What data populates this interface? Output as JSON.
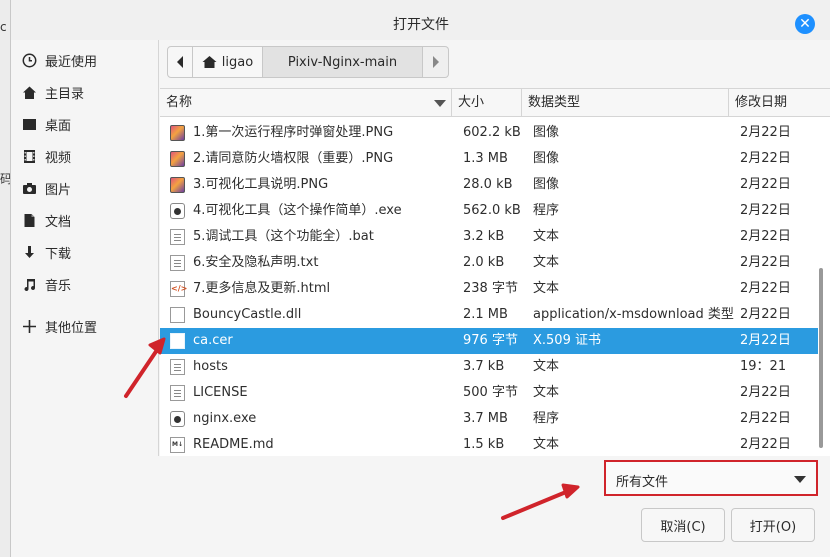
{
  "window": {
    "title": "打开文件"
  },
  "background": {
    "glyph_top": "c",
    "glyph_mid": "码"
  },
  "sidebar": {
    "items": [
      {
        "label": "最近使用",
        "icon": "clock-icon"
      },
      {
        "label": "主目录",
        "icon": "home-icon"
      },
      {
        "label": "桌面",
        "icon": "desktop-icon"
      },
      {
        "label": "视频",
        "icon": "video-icon"
      },
      {
        "label": "图片",
        "icon": "camera-icon"
      },
      {
        "label": "文档",
        "icon": "document-icon"
      },
      {
        "label": "下载",
        "icon": "download-icon"
      },
      {
        "label": "音乐",
        "icon": "music-icon"
      },
      {
        "label": "其他位置",
        "icon": "plus-icon"
      }
    ]
  },
  "pathbar": {
    "home": "ligao",
    "current": "Pixiv-Nginx-main"
  },
  "columns": {
    "name": "名称",
    "size": "大小",
    "type": "数据类型",
    "date": "修改日期"
  },
  "files": [
    {
      "name": "1.第一次运行程序时弹窗处理.PNG",
      "size": "602.2 kB",
      "type": "图像",
      "date": "2月22日",
      "icon": "image-icon"
    },
    {
      "name": "2.请同意防火墙权限（重要）.PNG",
      "size": "1.3 MB",
      "type": "图像",
      "date": "2月22日",
      "icon": "image-icon"
    },
    {
      "name": "3.可视化工具说明.PNG",
      "size": "28.0 kB",
      "type": "图像",
      "date": "2月22日",
      "icon": "image-icon"
    },
    {
      "name": "4.可视化工具（这个操作简单）.exe",
      "size": "562.0 kB",
      "type": "程序",
      "date": "2月22日",
      "icon": "executable-icon"
    },
    {
      "name": "5.调试工具（这个功能全）.bat",
      "size": "3.2 kB",
      "type": "文本",
      "date": "2月22日",
      "icon": "text-file-icon"
    },
    {
      "name": "6.安全及隐私声明.txt",
      "size": "2.0 kB",
      "type": "文本",
      "date": "2月22日",
      "icon": "text-file-icon"
    },
    {
      "name": "7.更多信息及更新.html",
      "size": "238 字节",
      "type": "文本",
      "date": "2月22日",
      "icon": "html-file-icon"
    },
    {
      "name": "BouncyCastle.dll",
      "size": "2.1 MB",
      "type": "application/x-msdownload 类型",
      "date": "2月22日",
      "icon": "blank-file-icon"
    },
    {
      "name": "ca.cer",
      "size": "976 字节",
      "type": "X.509 证书",
      "date": "2月22日",
      "icon": "certificate-file-icon",
      "selected": true
    },
    {
      "name": "hosts",
      "size": "3.7 kB",
      "type": "文本",
      "date": "19：21",
      "icon": "text-file-icon"
    },
    {
      "name": "LICENSE",
      "size": "500 字节",
      "type": "文本",
      "date": "2月22日",
      "icon": "text-file-icon"
    },
    {
      "name": "nginx.exe",
      "size": "3.7 MB",
      "type": "程序",
      "date": "2月22日",
      "icon": "executable-icon"
    },
    {
      "name": "README.md",
      "size": "1.5 kB",
      "type": "文本",
      "date": "2月22日",
      "icon": "markdown-file-icon"
    }
  ],
  "filter": {
    "selected": "所有文件"
  },
  "buttons": {
    "cancel": "取消(C)",
    "open": "打开(O)"
  },
  "colors": {
    "selection": "#2b9be0",
    "close": "#1e90ff",
    "annotation": "#d0242b"
  }
}
